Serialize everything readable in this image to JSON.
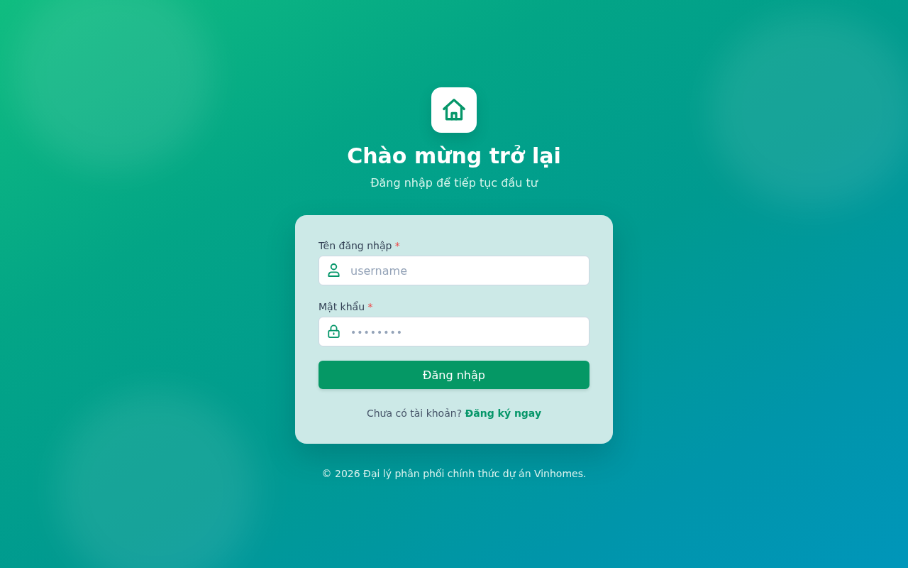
{
  "header": {
    "title": "Chào mừng trở lại",
    "subtitle": "Đăng nhập để tiếp tục đầu tư"
  },
  "form": {
    "fields": [
      {
        "kind": "username",
        "label": "Tên đăng nhập",
        "required_mark": "*",
        "placeholder": "username"
      },
      {
        "kind": "password",
        "label": "Mật khẩu",
        "required_mark": "*",
        "placeholder": "••••••••"
      }
    ],
    "submit_button": "Đăng nhập",
    "signup": {
      "prompt": "Chưa có tài khoản?",
      "link": "Đăng ký ngay"
    }
  },
  "footer": "© 2026 Đại lý phân phối chính thức dự án Vinhomes."
}
